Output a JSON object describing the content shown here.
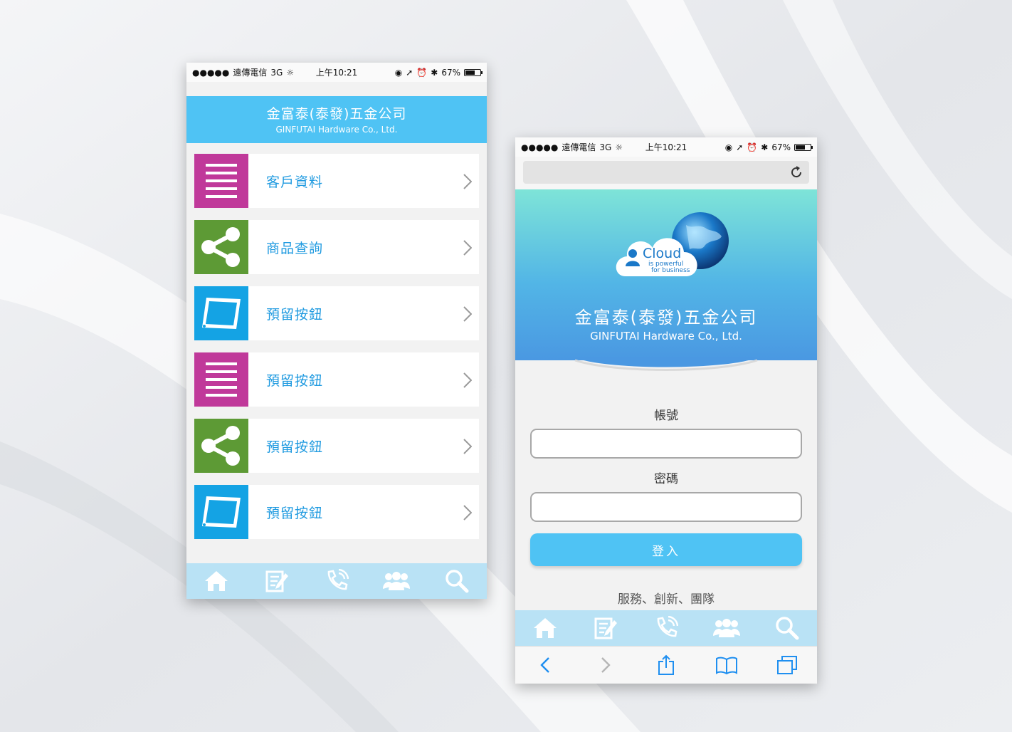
{
  "status_bar": {
    "carrier": "遠傳電信",
    "network": "3G",
    "time": "上午10:21",
    "battery": "67%"
  },
  "left_screen": {
    "title_zh": "金富泰(泰發)五金公司",
    "title_en": "GINFUTAI Hardware Co., Ltd.",
    "menu_items": [
      {
        "label": "客戶資料",
        "icon": "list-icon",
        "color": "#c0399a"
      },
      {
        "label": "商品查詢",
        "icon": "share-icon",
        "color": "#5d9a35"
      },
      {
        "label": "預留按鈕",
        "icon": "tablet-icon",
        "color": "#14a3e4"
      },
      {
        "label": "預留按鈕",
        "icon": "list-icon",
        "color": "#c0399a"
      },
      {
        "label": "預留按鈕",
        "icon": "share-icon",
        "color": "#5d9a35"
      },
      {
        "label": "預留按鈕",
        "icon": "tablet-icon",
        "color": "#14a3e4"
      }
    ]
  },
  "right_screen": {
    "logo": {
      "word": "Cloud",
      "line1": "is powerful",
      "line2": "for business"
    },
    "title_zh": "金富泰(泰發)五金公司",
    "title_en": "GINFUTAI Hardware Co., Ltd.",
    "account_label": "帳號",
    "password_label": "密碼",
    "account_value": "",
    "password_value": "",
    "login_label": "登入",
    "slogan": "服務、創新、團隊"
  },
  "tabbar": [
    "home-icon",
    "edit-icon",
    "phone-icon",
    "users-icon",
    "search-icon"
  ],
  "safari_toolbar": [
    "back-icon",
    "forward-icon",
    "share-sheet-icon",
    "bookmarks-icon",
    "tabs-icon"
  ],
  "colors": {
    "banner": "#4fc3f4",
    "tabbar": "#b9e2f5",
    "tab_icon": "#ffffff",
    "menu_text": "#1f9ae0"
  }
}
